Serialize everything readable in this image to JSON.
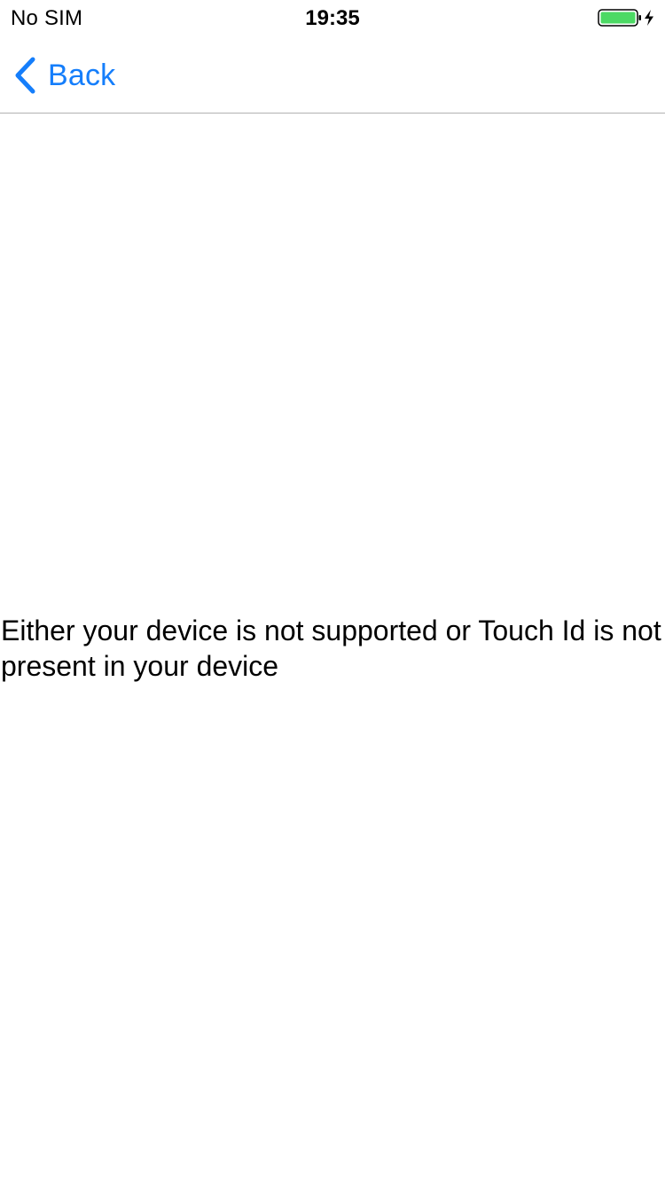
{
  "status_bar": {
    "carrier": "No SIM",
    "time": "19:35",
    "battery": {
      "level": 1.0,
      "charging": true,
      "color": "#4cd964"
    }
  },
  "nav_bar": {
    "back_label": "Back",
    "back_icon": "chevron-left-icon",
    "accent_color": "#157efb"
  },
  "main": {
    "message": "Either your device is not supported or Touch Id is not present in your device"
  }
}
